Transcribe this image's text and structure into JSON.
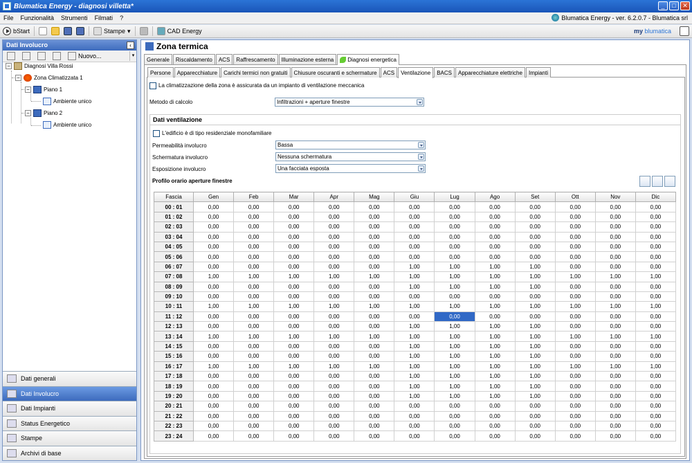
{
  "window": {
    "title": "Blumatica Energy - diagnosi villetta*"
  },
  "menu": {
    "items": [
      "File",
      "Funzionalità",
      "Strumenti",
      "Filmati",
      "?"
    ],
    "version": "Blumatica Energy - ver. 6.2.0.7 - Blumatica srl"
  },
  "toolbar": {
    "bstart": "bStart",
    "stampe": "Stampe",
    "cad": "CAD Energy",
    "logo_my": "my",
    "logo_brand": "blumatica"
  },
  "left": {
    "header": "Dati Involucro",
    "nuovo": "Nuovo...",
    "tree": {
      "root": "Diagnosi Villa Rossi",
      "zone": "Zona Climatizzata 1",
      "floor1": "Piano 1",
      "room1": "Ambiente unico",
      "floor2": "Piano 2",
      "room2": "Ambiente unico"
    },
    "nav": [
      "Dati generali",
      "Dati Involucro",
      "Dati Impianti",
      "Status Energetico",
      "Stampe",
      "Archivi di base"
    ]
  },
  "main": {
    "title": "Zona termica",
    "tabs1": [
      "Generale",
      "Riscaldamento",
      "ACS",
      "Raffrescamento",
      "Illuminazione esterna",
      "Diagnosi energetica"
    ],
    "tabs2": [
      "Persone",
      "Apparecchiature",
      "Carichi termici non gratuiti",
      "Chiusure oscuranti e schermature",
      "ACS",
      "Ventilazione",
      "BACS",
      "Apparecchiature elettriche",
      "Impianti"
    ],
    "mech_vent_label": "La climatizzazione della zona è assicurata da un impianto di ventilazione meccanica",
    "metodo_label": "Metodo di calcolo",
    "metodo_value": "Infiltrazioni + aperture finestre",
    "section_title": "Dati ventilazione",
    "residenziale_label": "L'edificio è di tipo residenziale monofamiliare",
    "permeabilita_label": "Permeabilità involucro",
    "permeabilita_value": "Bassa",
    "schermatura_label": "Schermatura involucro",
    "schermatura_value": "Nessuna schermatura",
    "esposizione_label": "Esposizione involucro",
    "esposizione_value": "Una facciata esposta",
    "profile_title": "Profilo orario aperture finestre"
  },
  "table": {
    "headers": [
      "Fascia",
      "Gen",
      "Feb",
      "Mar",
      "Apr",
      "Mag",
      "Giu",
      "Lug",
      "Ago",
      "Set",
      "Ott",
      "Nov",
      "Dic"
    ],
    "rows": [
      [
        "00 : 01",
        "0,00",
        "0,00",
        "0,00",
        "0,00",
        "0,00",
        "0,00",
        "0,00",
        "0,00",
        "0,00",
        "0,00",
        "0,00",
        "0,00"
      ],
      [
        "01 : 02",
        "0,00",
        "0,00",
        "0,00",
        "0,00",
        "0,00",
        "0,00",
        "0,00",
        "0,00",
        "0,00",
        "0,00",
        "0,00",
        "0,00"
      ],
      [
        "02 : 03",
        "0,00",
        "0,00",
        "0,00",
        "0,00",
        "0,00",
        "0,00",
        "0,00",
        "0,00",
        "0,00",
        "0,00",
        "0,00",
        "0,00"
      ],
      [
        "03 : 04",
        "0,00",
        "0,00",
        "0,00",
        "0,00",
        "0,00",
        "0,00",
        "0,00",
        "0,00",
        "0,00",
        "0,00",
        "0,00",
        "0,00"
      ],
      [
        "04 : 05",
        "0,00",
        "0,00",
        "0,00",
        "0,00",
        "0,00",
        "0,00",
        "0,00",
        "0,00",
        "0,00",
        "0,00",
        "0,00",
        "0,00"
      ],
      [
        "05 : 06",
        "0,00",
        "0,00",
        "0,00",
        "0,00",
        "0,00",
        "0,00",
        "0,00",
        "0,00",
        "0,00",
        "0,00",
        "0,00",
        "0,00"
      ],
      [
        "06 : 07",
        "0,00",
        "0,00",
        "0,00",
        "0,00",
        "0,00",
        "1,00",
        "1,00",
        "1,00",
        "1,00",
        "0,00",
        "0,00",
        "0,00"
      ],
      [
        "07 : 08",
        "1,00",
        "1,00",
        "1,00",
        "1,00",
        "1,00",
        "1,00",
        "1,00",
        "1,00",
        "1,00",
        "1,00",
        "1,00",
        "1,00"
      ],
      [
        "08 : 09",
        "0,00",
        "0,00",
        "0,00",
        "0,00",
        "0,00",
        "1,00",
        "1,00",
        "1,00",
        "1,00",
        "0,00",
        "0,00",
        "0,00"
      ],
      [
        "09 : 10",
        "0,00",
        "0,00",
        "0,00",
        "0,00",
        "0,00",
        "0,00",
        "0,00",
        "0,00",
        "0,00",
        "0,00",
        "0,00",
        "0,00"
      ],
      [
        "10 : 11",
        "1,00",
        "1,00",
        "1,00",
        "1,00",
        "1,00",
        "1,00",
        "1,00",
        "1,00",
        "1,00",
        "1,00",
        "1,00",
        "1,00"
      ],
      [
        "11 : 12",
        "0,00",
        "0,00",
        "0,00",
        "0,00",
        "0,00",
        "0,00",
        "0,00",
        "0,00",
        "0,00",
        "0,00",
        "0,00",
        "0,00"
      ],
      [
        "12 : 13",
        "0,00",
        "0,00",
        "0,00",
        "0,00",
        "0,00",
        "1,00",
        "1,00",
        "1,00",
        "1,00",
        "0,00",
        "0,00",
        "0,00"
      ],
      [
        "13 : 14",
        "1,00",
        "1,00",
        "1,00",
        "1,00",
        "1,00",
        "1,00",
        "1,00",
        "1,00",
        "1,00",
        "1,00",
        "1,00",
        "1,00"
      ],
      [
        "14 : 15",
        "0,00",
        "0,00",
        "0,00",
        "0,00",
        "0,00",
        "1,00",
        "1,00",
        "1,00",
        "1,00",
        "0,00",
        "0,00",
        "0,00"
      ],
      [
        "15 : 16",
        "0,00",
        "0,00",
        "0,00",
        "0,00",
        "0,00",
        "1,00",
        "1,00",
        "1,00",
        "1,00",
        "0,00",
        "0,00",
        "0,00"
      ],
      [
        "16 : 17",
        "1,00",
        "1,00",
        "1,00",
        "1,00",
        "1,00",
        "1,00",
        "1,00",
        "1,00",
        "1,00",
        "1,00",
        "1,00",
        "1,00"
      ],
      [
        "17 : 18",
        "0,00",
        "0,00",
        "0,00",
        "0,00",
        "0,00",
        "1,00",
        "1,00",
        "1,00",
        "1,00",
        "0,00",
        "0,00",
        "0,00"
      ],
      [
        "18 : 19",
        "0,00",
        "0,00",
        "0,00",
        "0,00",
        "0,00",
        "1,00",
        "1,00",
        "1,00",
        "1,00",
        "0,00",
        "0,00",
        "0,00"
      ],
      [
        "19 : 20",
        "0,00",
        "0,00",
        "0,00",
        "0,00",
        "0,00",
        "1,00",
        "1,00",
        "1,00",
        "1,00",
        "0,00",
        "0,00",
        "0,00"
      ],
      [
        "20 : 21",
        "0,00",
        "0,00",
        "0,00",
        "0,00",
        "0,00",
        "0,00",
        "0,00",
        "0,00",
        "0,00",
        "0,00",
        "0,00",
        "0,00"
      ],
      [
        "21 : 22",
        "0,00",
        "0,00",
        "0,00",
        "0,00",
        "0,00",
        "0,00",
        "0,00",
        "0,00",
        "0,00",
        "0,00",
        "0,00",
        "0,00"
      ],
      [
        "22 : 23",
        "0,00",
        "0,00",
        "0,00",
        "0,00",
        "0,00",
        "0,00",
        "0,00",
        "0,00",
        "0,00",
        "0,00",
        "0,00",
        "0,00"
      ],
      [
        "23 : 24",
        "0,00",
        "0,00",
        "0,00",
        "0,00",
        "0,00",
        "0,00",
        "0,00",
        "0,00",
        "0,00",
        "0,00",
        "0,00",
        "0,00"
      ]
    ],
    "selected": {
      "row": 11,
      "col": 7
    }
  }
}
